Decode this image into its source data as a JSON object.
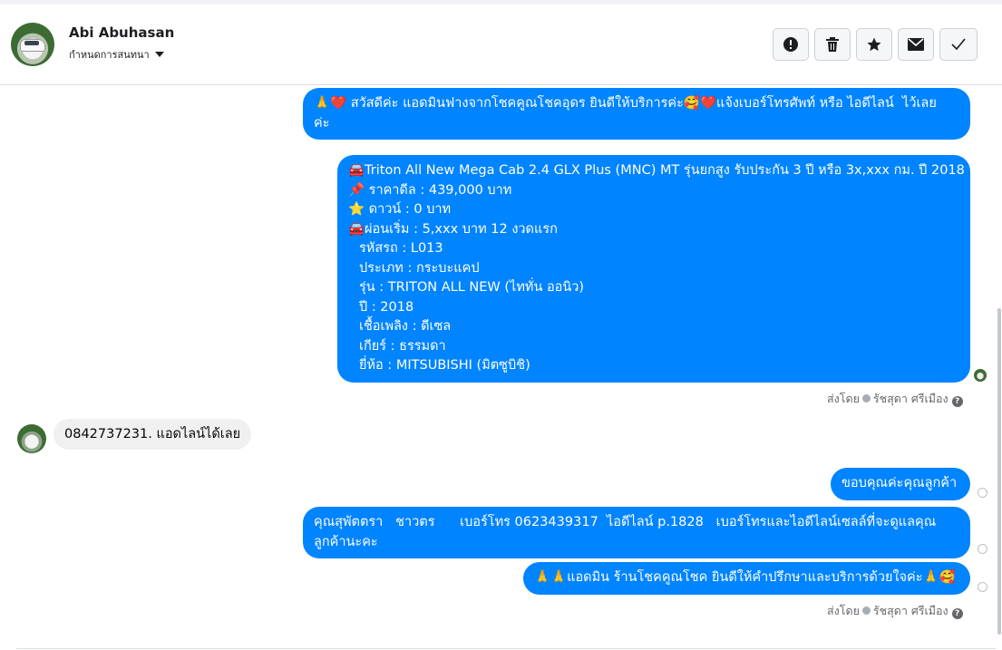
{
  "header": {
    "name": "Abi Abuhasan",
    "assign_label": "กำหนดการสนทนา",
    "toolbar": [
      {
        "icon": "alert-icon",
        "glyph": "❗"
      },
      {
        "icon": "trash-icon",
        "glyph": "🗑"
      },
      {
        "icon": "star-icon",
        "glyph": "★"
      },
      {
        "icon": "envelope-icon",
        "glyph": "✉"
      },
      {
        "icon": "check-icon",
        "glyph": "✓"
      }
    ]
  },
  "messages": {
    "m1": {
      "line1": "🙏❤️ สวัสดีค่ะ แอดมินฟางจากโชคคูณโชคอุดร ยินดีให้บริการค่ะ🥰❤️แจ้งเบอร์โทรศัพท์ หรือ ไอดีไลน์  ไว้เลย",
      "line2": "ค่ะ"
    },
    "m2": {
      "lines": [
        "🚘Triton All New Mega Cab 2.4 GLX Plus (MNC) MT รุ่นยกสูง รับประกัน 3 ปี หรือ 3x,xxx กม. ปี 2018",
        "📌 ราคาดีล : 439,000 บาท",
        "⭐ ดาวน์ : 0 บาท",
        "🚘ผ่อนเริ่ม : 5,xxx บาท 12 งวดแรก",
        "รหัสรถ : L013",
        "ประเภท : กระบะแคป",
        "รุ่น : TRITON ALL NEW (ไททั่น ออนิว)",
        "ปี : 2018",
        "เชื้อเพลิง : ดีเซล",
        "เกียร์ : ธรรมดา",
        "ยี่ห้อ : MITSUBISHI (มิตซูบิชิ)"
      ]
    },
    "sent_by_1": {
      "prefix": "ส่งโดย",
      "agent": "รัชสุดา ศรีเมือง"
    },
    "m3": {
      "text": "0842737231. แอดไลน์ได้เลย"
    },
    "m4": {
      "text": "ขอบคุณค่ะคุณลูกค้า"
    },
    "m5": {
      "line1": "คุณสุพัตตรา   ชาวตร      เบอร์โทร 0623439317  ไอดีไลน์ p.1828   เบอร์โทรและไอดีไลน์เซลล์ที่จะดูแลคุณ",
      "line2": "ลูกค้านะคะ"
    },
    "m6": {
      "text": "🙏🙏แอดมิน ร้านโชคคูณโชค ยินดีให้คำปรึกษาและบริการด้วยใจค่ะ🙏🥰"
    },
    "sent_by_2": {
      "prefix": "ส่งโดย",
      "agent": "รัชสุดา ศรีเมือง"
    }
  },
  "colors": {
    "outgoing": "#0084ff",
    "incoming": "#f1f0f0"
  }
}
